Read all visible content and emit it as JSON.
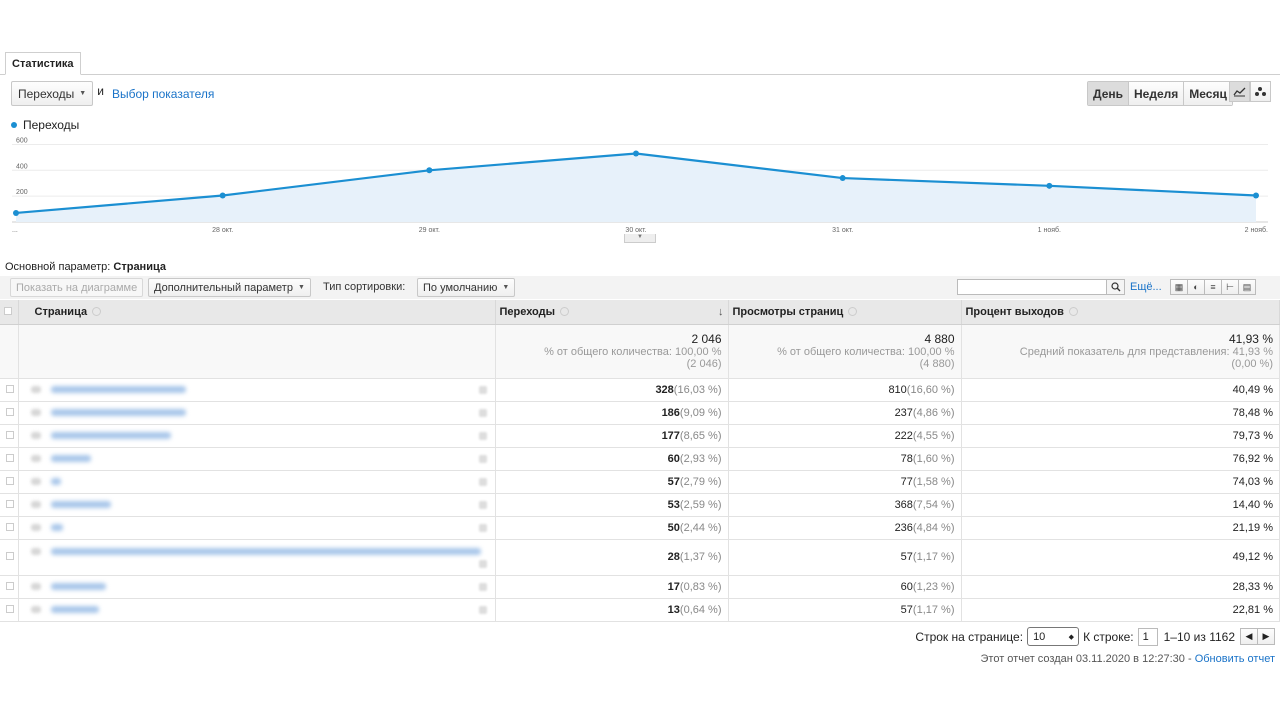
{
  "tabs": [
    "Статистика"
  ],
  "metric_selector": {
    "value": "Переходы",
    "and": "и",
    "choose_link": "Выбор показателя"
  },
  "periods": [
    "День",
    "Неделя",
    "Месяц"
  ],
  "chart_data": {
    "type": "area",
    "legend": "Переходы",
    "x": [
      "...",
      "28 окт.",
      "29 окт.",
      "30 окт.",
      "31 окт.",
      "1 нояб.",
      "2 нояб."
    ],
    "series": [
      {
        "name": "Переходы",
        "values": [
          70,
          205,
          400,
          530,
          340,
          280,
          205
        ]
      }
    ],
    "y_ticks": [
      200,
      400,
      600
    ],
    "ylim": [
      0,
      650
    ],
    "grid": true,
    "color": "#1b8fd2"
  },
  "dimension": {
    "label": "Основной параметр:",
    "value": "Страница"
  },
  "toolbar": {
    "show_on_chart": "Показать на диаграмме",
    "secondary_param": "Дополнительный параметр",
    "sort_label": "Тип сортировки:",
    "sort_value": "По умолчанию",
    "more": "Ещё..."
  },
  "table": {
    "headers": {
      "page": "Страница",
      "visits": "Переходы",
      "pageviews": "Просмотры страниц",
      "exit": "Процент выходов"
    },
    "totals": {
      "visits": {
        "value": "2 046",
        "sub1": "% от общего количества: 100,00 %",
        "sub2": "(2 046)"
      },
      "pageviews": {
        "value": "4 880",
        "sub1": "% от общего количества: 100,00 %",
        "sub2": "(4 880)"
      },
      "exit": {
        "value": "41,93 %",
        "sub1": "Средний показатель для представления: 41,93 %",
        "sub2": "(0,00 %)"
      }
    },
    "rows": [
      {
        "visits": "328",
        "visits_pct": "(16,03 %)",
        "pv": "810",
        "pv_pct": "(16,60 %)",
        "exit": "40,49 %"
      },
      {
        "visits": "186",
        "visits_pct": "(9,09 %)",
        "pv": "237",
        "pv_pct": "(4,86 %)",
        "exit": "78,48 %"
      },
      {
        "visits": "177",
        "visits_pct": "(8,65 %)",
        "pv": "222",
        "pv_pct": "(4,55 %)",
        "exit": "79,73 %"
      },
      {
        "visits": "60",
        "visits_pct": "(2,93 %)",
        "pv": "78",
        "pv_pct": "(1,60 %)",
        "exit": "76,92 %"
      },
      {
        "visits": "57",
        "visits_pct": "(2,79 %)",
        "pv": "77",
        "pv_pct": "(1,58 %)",
        "exit": "74,03 %"
      },
      {
        "visits": "53",
        "visits_pct": "(2,59 %)",
        "pv": "368",
        "pv_pct": "(7,54 %)",
        "exit": "14,40 %"
      },
      {
        "visits": "50",
        "visits_pct": "(2,44 %)",
        "pv": "236",
        "pv_pct": "(4,84 %)",
        "exit": "21,19 %"
      },
      {
        "visits": "28",
        "visits_pct": "(1,37 %)",
        "pv": "57",
        "pv_pct": "(1,17 %)",
        "exit": "49,12 %"
      },
      {
        "visits": "17",
        "visits_pct": "(0,83 %)",
        "pv": "60",
        "pv_pct": "(1,23 %)",
        "exit": "28,33 %"
      },
      {
        "visits": "13",
        "visits_pct": "(0,64 %)",
        "pv": "57",
        "pv_pct": "(1,17 %)",
        "exit": "22,81 %"
      }
    ]
  },
  "pager": {
    "rows_label": "Строк на странице:",
    "rows_value": "10",
    "goto_label": "К строке:",
    "goto_value": "1",
    "range": "1–10 из 1162"
  },
  "footer": {
    "created": "Этот отчет создан 03.11.2020 в 12:27:30 -",
    "refresh": "Обновить отчет"
  }
}
